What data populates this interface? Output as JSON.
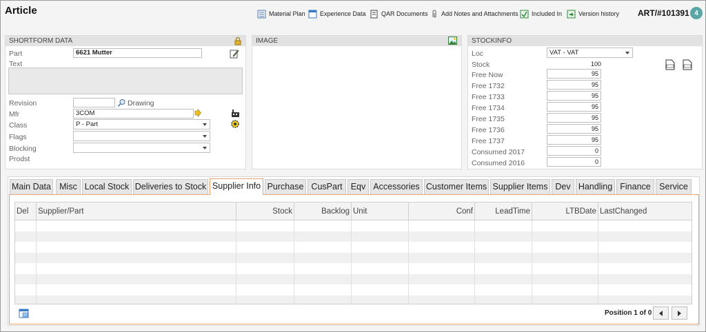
{
  "page": {
    "title": "Article"
  },
  "toolbar": {
    "items": [
      {
        "label": "Material Plan",
        "icon": "material-plan-icon"
      },
      {
        "label": "Experience Data",
        "icon": "experience-data-icon"
      },
      {
        "label": "QAR Documents",
        "icon": "qar-documents-icon"
      },
      {
        "label": "Add Notes and Attachments",
        "icon": "paperclip-icon"
      },
      {
        "label": "Included In",
        "icon": "included-in-icon"
      },
      {
        "label": "Version history",
        "icon": "version-history-icon"
      }
    ]
  },
  "article": {
    "id": "ART/#101391",
    "badge": "4"
  },
  "shortform": {
    "heading": "SHORTFORM DATA",
    "part_label": "Part",
    "part_value": "6621 Mutter",
    "text_label": "Text",
    "text_value": "",
    "revision_label": "Revision",
    "revision_value": "",
    "drawing_label": "Drawing",
    "mfr_label": "Mfr",
    "mfr_value": "3COM",
    "class_label": "Class",
    "class_value": "P - Part",
    "flags_label": "Flags",
    "flags_value": "",
    "blocking_label": "Blocking",
    "blocking_value": "",
    "prodst_label": "Prodst"
  },
  "image_panel": {
    "heading": "IMAGE"
  },
  "stockinfo": {
    "heading": "STOCKINFO",
    "loc_label": "Loc",
    "loc_value": "VAT - VAT",
    "stock_label": "Stock",
    "stock_value": "100",
    "rows": [
      {
        "label": "Free Now",
        "value": "95"
      },
      {
        "label": "Free 1732",
        "value": "95"
      },
      {
        "label": "Free 1733",
        "value": "95"
      },
      {
        "label": "Free 1734",
        "value": "95"
      },
      {
        "label": "Free 1735",
        "value": "95"
      },
      {
        "label": "Free 1736",
        "value": "95"
      },
      {
        "label": "Free 1737",
        "value": "95"
      },
      {
        "label": "Consumed 2017",
        "value": "0"
      },
      {
        "label": "Consumed 2016",
        "value": "0"
      }
    ]
  },
  "tabs": [
    {
      "label": "Main Data"
    },
    {
      "label": "Misc"
    },
    {
      "label": "Local Stock"
    },
    {
      "label": "Deliveries to Stock"
    },
    {
      "label": "Supplier Info",
      "active": true
    },
    {
      "label": "Purchase"
    },
    {
      "label": "CusPart"
    },
    {
      "label": "Eqv"
    },
    {
      "label": "Accessories"
    },
    {
      "label": "Customer Items"
    },
    {
      "label": "Supplier Items"
    },
    {
      "label": "Dev"
    },
    {
      "label": "Handling"
    },
    {
      "label": "Finance"
    },
    {
      "label": "Service"
    }
  ],
  "grid": {
    "columns": [
      {
        "label": "Del",
        "align": "left"
      },
      {
        "label": "Supplier/Part",
        "align": "left"
      },
      {
        "label": "Stock",
        "align": "right"
      },
      {
        "label": "Backlog",
        "align": "right"
      },
      {
        "label": "Unit",
        "align": "left"
      },
      {
        "label": "Conf",
        "align": "right"
      },
      {
        "label": "LeadTime",
        "align": "right"
      },
      {
        "label": "LTBDate",
        "align": "right"
      },
      {
        "label": "LastChanged",
        "align": "left"
      }
    ],
    "rows": []
  },
  "pager": {
    "position_text": "Position 1 of 0"
  },
  "colors": {
    "active_tab_border": "#e8a070",
    "badge": "#5aa6a6"
  }
}
